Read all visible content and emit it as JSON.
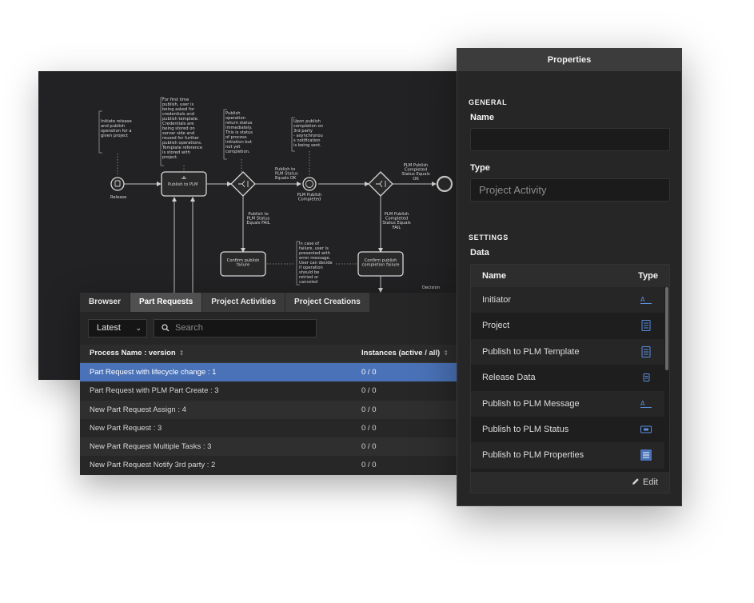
{
  "diagram": {
    "annotations": [
      [
        "Initiate release",
        "and publish",
        "operation for a",
        "given project"
      ],
      [
        "For first time",
        "publish, user is",
        "being asked for",
        "credentials and",
        "publish template.",
        "Credentials are",
        "being stored on",
        "server side and",
        "reused for further",
        "publish operations.",
        "Template reference",
        "is stored with",
        "project."
      ],
      [
        "Publish",
        "operation",
        "return status",
        "immediately.",
        "This is status",
        "of process",
        "initiation but",
        "not yet",
        "completion."
      ],
      [
        "Upon publish",
        "completion on",
        "3rd party",
        "- asynchronou",
        "s notification",
        "is being sent."
      ],
      [
        "In case of",
        "failure, user is",
        "presented with",
        "error message.",
        "User can decide",
        "if operation",
        "should be",
        "retried or",
        "canceled"
      ]
    ],
    "labels": {
      "release": "Release",
      "publish_task": "Publish to PLM",
      "status_ok": [
        "Publish to",
        "PLM Status",
        "Equals OK"
      ],
      "status_fail": [
        "Publish to",
        "PLM Status",
        "Equals FAIL"
      ],
      "completed_event": [
        "PLM Publish",
        "Completed"
      ],
      "completed_ok": [
        "PLM Publish",
        "Completed",
        "Status Equals",
        "OK"
      ],
      "completed_fail": [
        "PLM Publish",
        "Completed",
        "Status Equals",
        "FAIL"
      ],
      "confirm_failure": [
        "Confirm publish",
        "failure"
      ],
      "confirm_completion_failure": [
        "Confirm publish",
        "completion failure"
      ],
      "decision": "Decision"
    }
  },
  "browser": {
    "tabs": [
      "Browser",
      "Part Requests",
      "Project Activities",
      "Project Creations"
    ],
    "active_tab": "Part Requests",
    "version_select": "Latest",
    "search_placeholder": "Search",
    "columns": [
      "Process Name : version",
      "Instances (active / all)"
    ],
    "rows": [
      {
        "name": "Part Request with lifecycle change : 1",
        "instances": "0 / 0",
        "selected": true
      },
      {
        "name": "Part Request with PLM Part Create : 3",
        "instances": "0 / 0"
      },
      {
        "name": "New Part Request Assign : 4",
        "instances": "0 / 0"
      },
      {
        "name": "New Part Request : 3",
        "instances": "0 / 0"
      },
      {
        "name": "New Part Request Multiple Tasks : 3",
        "instances": "0 / 0"
      },
      {
        "name": "New Part Request Notify 3rd party : 2",
        "instances": "0 / 0"
      }
    ]
  },
  "properties": {
    "title": "Properties",
    "general_heading": "GENERAL",
    "name_label": "Name",
    "name_value": "",
    "type_label": "Type",
    "type_value": "Project Activity",
    "settings_heading": "SETTINGS",
    "data_label": "Data",
    "data_columns": [
      "Name",
      "Type"
    ],
    "data_rows": [
      {
        "name": "Initiator",
        "icon": "text-field-icon"
      },
      {
        "name": "Project",
        "icon": "document-icon"
      },
      {
        "name": "Publish to PLM Template",
        "icon": "document-icon"
      },
      {
        "name": "Release Data",
        "icon": "small-document-icon"
      },
      {
        "name": "Publish to PLM Message",
        "icon": "text-field-icon"
      },
      {
        "name": "Publish to PLM Status",
        "icon": "status-box-icon"
      },
      {
        "name": "Publish to PLM Properties",
        "icon": "list-icon"
      }
    ],
    "edit_label": "Edit",
    "accent_color": "#4a72b8"
  }
}
